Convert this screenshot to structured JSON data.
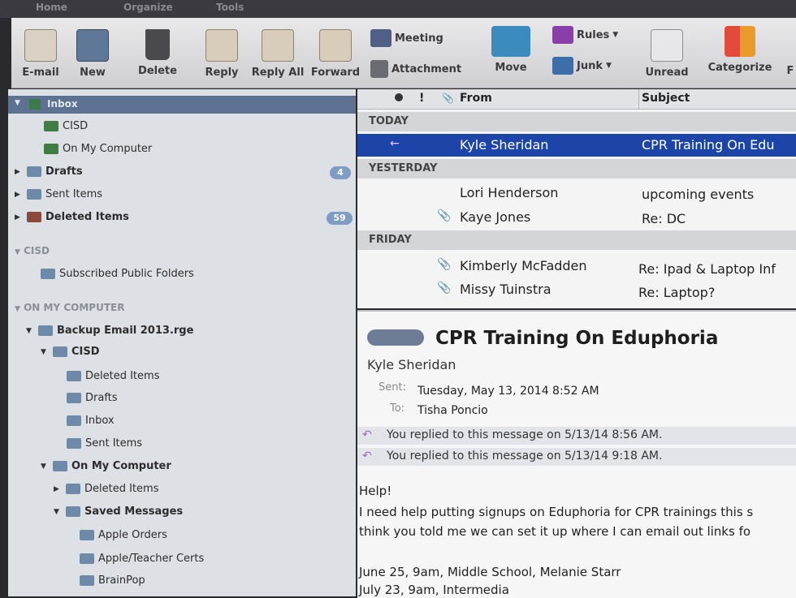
{
  "tabs": [
    "Home",
    "Organize",
    "Tools"
  ],
  "ribbon": {
    "email": "E-mail",
    "new": "New",
    "delete": "Delete",
    "reply": "Reply",
    "reply_all": "Reply All",
    "forward": "Forward",
    "meeting": "Meeting",
    "attachment": "Attachment",
    "move": "Move",
    "rules": "Rules",
    "junk": "Junk",
    "unread": "Unread",
    "categorize": "Categorize",
    "cut_letter": "F"
  },
  "sidebar": {
    "inbox_header": "Inbox",
    "cisd": "CISD",
    "on_my_computer": "On My Computer",
    "drafts": "Drafts",
    "drafts_count": "4",
    "sent_items": "Sent Items",
    "deleted_items": "Deleted Items",
    "deleted_count": "59",
    "section_cisd": "CISD",
    "subscribed": "Subscribed Public Folders",
    "section_omc": "ON MY COMPUTER",
    "backup": "Backup Email 2013.rge",
    "sub_cisd": "CISD",
    "sub_deleted": "Deleted Items",
    "sub_drafts": "Drafts",
    "sub_inbox": "Inbox",
    "sub_sent": "Sent Items",
    "sub_omc": "On My Computer",
    "sub2_deleted": "Deleted Items",
    "saved": "Saved Messages",
    "apple_orders": "Apple Orders",
    "apple_teacher": "Apple/Teacher Certs",
    "brainpop": "BrainPop"
  },
  "list": {
    "col_from": "From",
    "col_subject": "Subject",
    "groups": [
      "TODAY",
      "YESTERDAY",
      "FRIDAY"
    ],
    "messages": [
      {
        "from": "Kyle Sheridan",
        "subject": "CPR Training On Edu"
      },
      {
        "from": "Lori Henderson",
        "subject": "upcoming events"
      },
      {
        "from": "Kaye Jones",
        "subject": "Re: DC"
      },
      {
        "from": "Kimberly McFadden",
        "subject": "Re: Ipad & Laptop Inf"
      },
      {
        "from": "Missy Tuinstra",
        "subject": "Re: Laptop?"
      }
    ]
  },
  "preview": {
    "title": "CPR Training On Eduphoria",
    "sender": "Kyle Sheridan",
    "sent_label": "Sent:",
    "sent_value": "Tuesday, May 13, 2014 8:52 AM",
    "to_label": "To:",
    "to_value": "Tisha Poncio",
    "reply1": "You replied to this message on 5/13/14 8:56 AM.",
    "reply2": "You replied to this message on 5/13/14 9:18 AM.",
    "body": [
      "Help!",
      "I need help putting signups on Eduphoria for CPR trainings this s",
      "think you told me we can set it up where I can email out links fo",
      "",
      "June 25, 9am, Middle School, Melanie Starr",
      "July 23, 9am, Intermedia"
    ]
  }
}
